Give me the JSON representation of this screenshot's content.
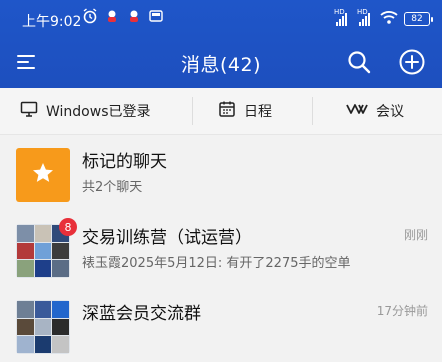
{
  "status_bar": {
    "time": "上午9:02",
    "network_label_1": "HD",
    "network_label_2": "HD",
    "battery": "82"
  },
  "header": {
    "title": "消息(42)"
  },
  "quick_bar": {
    "windows_label": "Windows已登录",
    "schedule_label": "日程",
    "meeting_label": "会议"
  },
  "conversations": [
    {
      "title": "标记的聊天",
      "subtitle": "共2个聊天",
      "time": "",
      "avatar_type": "star-icon"
    },
    {
      "title": "交易训练营（试运营）",
      "subtitle": "裱玉霞2025年5月12日: 有开了2275手的空单",
      "time": "刚刚",
      "badge": "8",
      "avatar_type": "group-avatar"
    },
    {
      "title": "深蓝会员交流群",
      "subtitle": "",
      "time": "17分钟前",
      "avatar_type": "group-avatar"
    }
  ],
  "colors": {
    "header": "#1f56c9",
    "star_avatar": "#f79a1b",
    "badge": "#e8303a"
  }
}
